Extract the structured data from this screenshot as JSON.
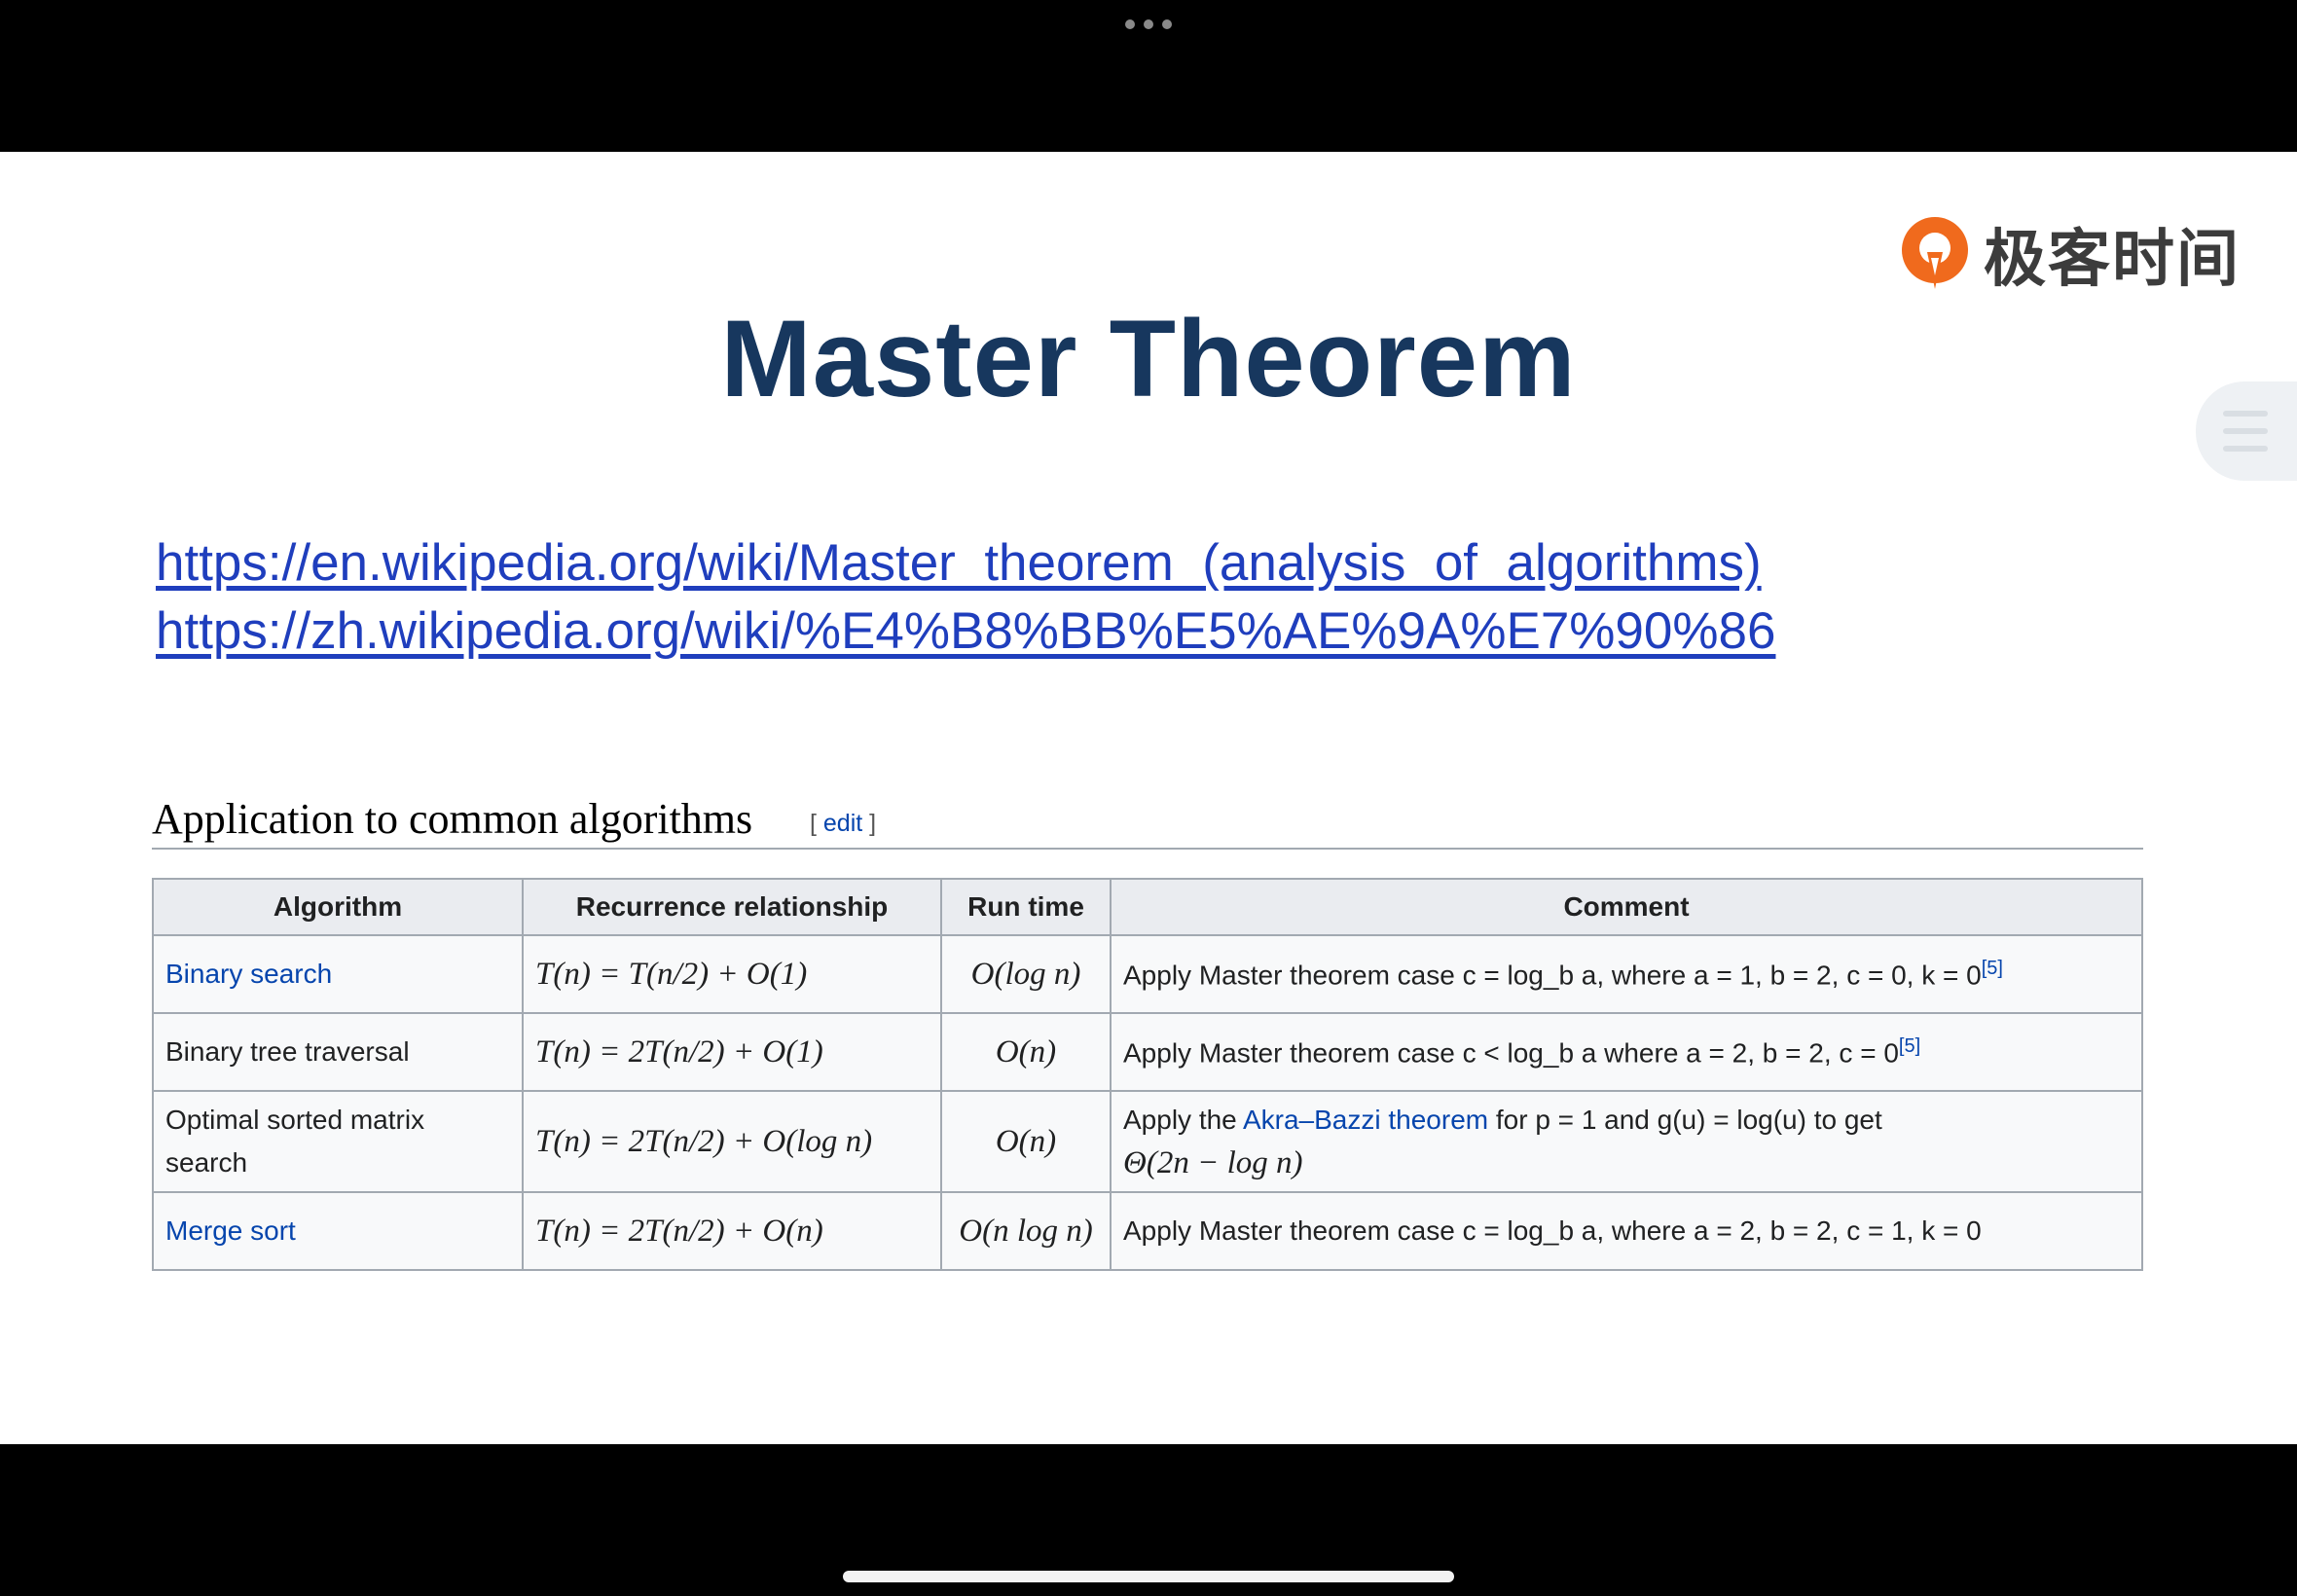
{
  "slide": {
    "title": "Master Theorem",
    "logo_text": "极客时间",
    "links": [
      "https://en.wikipedia.org/wiki/Master_theorem_(analysis_of_algorithms)",
      "https://zh.wikipedia.org/wiki/%E4%B8%BB%E5%AE%9A%E7%90%86"
    ],
    "section_title": "Application to common algorithms",
    "edit": {
      "open": "[",
      "label": "edit",
      "close": "]"
    },
    "table": {
      "headers": [
        "Algorithm",
        "Recurrence relationship",
        "Run time",
        "Comment"
      ],
      "rows": [
        {
          "algorithm": "Binary search",
          "recurrence": "T(n) = T(n/2) + O(1)",
          "runtime": "O(log n)",
          "comment": "Apply Master theorem case c = log_b a, where a = 1, b = 2, c = 0, k = 0",
          "ref": "[5]"
        },
        {
          "algorithm": "Binary tree traversal",
          "recurrence": "T(n) = 2T(n/2) + O(1)",
          "runtime": "O(n)",
          "comment": "Apply Master theorem case c < log_b a where a = 2, b = 2, c = 0",
          "ref": "[5]"
        },
        {
          "algorithm": "Optimal sorted matrix search",
          "recurrence": "T(n) = 2T(n/2) + O(log n)",
          "runtime": "O(n)",
          "comment_pre": "Apply the",
          "comment_link": "Akra–Bazzi theorem",
          "comment_post": "for p = 1 and g(u) = log(u) to get",
          "comment_line2": "Θ(2n − log n)"
        },
        {
          "algorithm": "Merge sort",
          "recurrence": "T(n) = 2T(n/2) + O(n)",
          "runtime": "O(n log n)",
          "comment": "Apply Master theorem case c = log_b a, where a = 2, b = 2, c = 1, k = 0"
        }
      ]
    }
  },
  "colors": {
    "title": "#17375e",
    "link": "#1f3ebd",
    "wiki_link": "#0645ad",
    "logo_orange": "#f06a1d"
  }
}
